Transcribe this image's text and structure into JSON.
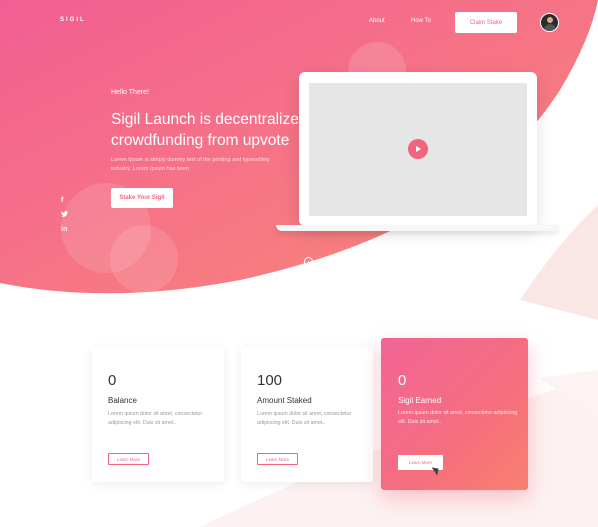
{
  "nav": {
    "logo": "SIGIL",
    "links": [
      "About",
      "How To"
    ],
    "cta": "Claim Stake"
  },
  "hero": {
    "greeting": "Hello There!",
    "headline": "Sigil Launch is decentralized crowdfunding from upvote",
    "subtext": "Lorem Ipsum is simply dummy text of the printing and typesetting industry. Lorem Ipsum has been",
    "button": "Stake Your Sigil",
    "play_video": "PLAY VIDEO",
    "social": [
      "f",
      "t",
      "in"
    ]
  },
  "cards": [
    {
      "value": "0",
      "label": "Balance",
      "desc": "Lorem ipsum dolor sit amet, consectetur adipiscing elit. Duis sit amet..",
      "button": "Learn More"
    },
    {
      "value": "100",
      "label": "Amount Staked",
      "desc": "Lorem ipsum dolor sit amet, consectetur adipiscing elit. Duis sit amet..",
      "button": "Learn More"
    },
    {
      "value": "0",
      "label": "Sigil Earned",
      "desc": "Lorem ipsum dolor sit amet, consectetur adipiscing elit. Duis sit amet..",
      "button": "Learn More"
    }
  ],
  "colors": {
    "accent": "#f0657d",
    "gradient_start": "#f25e93",
    "gradient_end": "#f98a78"
  },
  "icons": [
    "facebook-icon",
    "twitter-icon",
    "linkedin-icon",
    "play-icon",
    "mouse-scroll-icon",
    "avatar"
  ]
}
